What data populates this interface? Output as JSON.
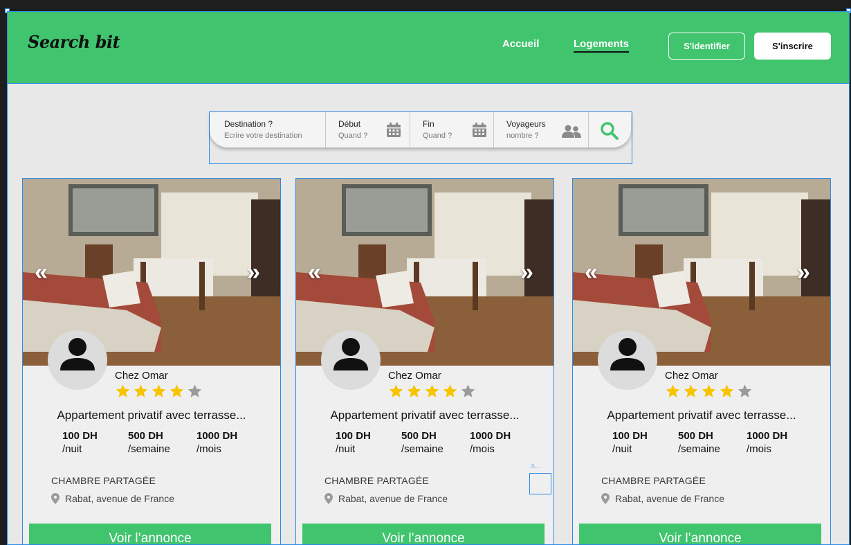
{
  "header": {
    "logo": "Search bit",
    "nav": [
      {
        "label": "Accueil"
      },
      {
        "label": "Logements"
      }
    ],
    "login_label": "S'identifier",
    "signup_label": "S'inscrire"
  },
  "search": {
    "destination": {
      "label": "Destination ?",
      "placeholder": "Ecrire votre destination"
    },
    "start": {
      "label": "Début",
      "placeholder": "Quand ?"
    },
    "end": {
      "label": "Fin",
      "placeholder": "Quand ?"
    },
    "travelers": {
      "label": "Voyageurs",
      "placeholder": "nombre ?"
    }
  },
  "listings": [
    {
      "host": "Chez Omar",
      "rating": 4,
      "title": "Appartement privatif avec terrasse...",
      "prices": [
        {
          "amount": "100 DH",
          "unit": "/nuit"
        },
        {
          "amount": "500 DH",
          "unit": "/semaine"
        },
        {
          "amount": "1000 DH",
          "unit": "/mois"
        }
      ],
      "type": "CHAMBRE PARTAGÉE",
      "location": "Rabat, avenue de France",
      "cta": "Voir l’annonce"
    },
    {
      "host": "Chez Omar",
      "rating": 4,
      "title": "Appartement privatif avec terrasse...",
      "prices": [
        {
          "amount": "100 DH",
          "unit": "/nuit"
        },
        {
          "amount": "500 DH",
          "unit": "/semaine"
        },
        {
          "amount": "1000 DH",
          "unit": "/mois"
        }
      ],
      "type": "CHAMBRE PARTAGÉE",
      "location": "Rabat, avenue de France",
      "cta": "Voir l’annonce"
    },
    {
      "host": "Chez Omar",
      "rating": 4,
      "title": "Appartement privatif avec terrasse...",
      "prices": [
        {
          "amount": "100 DH",
          "unit": "/nuit"
        },
        {
          "amount": "500 DH",
          "unit": "/semaine"
        },
        {
          "amount": "1000 DH",
          "unit": "/mois"
        }
      ],
      "type": "CHAMBRE PARTAGÉE",
      "location": "Rabat, avenue de France",
      "cta": "Voir l’annonce"
    }
  ],
  "editor": {
    "frame_label": "a..."
  },
  "colors": {
    "brand": "#41c46e",
    "selection": "#2b8ae6",
    "star": "#f7c400",
    "star_empty": "#9a9a9a"
  }
}
